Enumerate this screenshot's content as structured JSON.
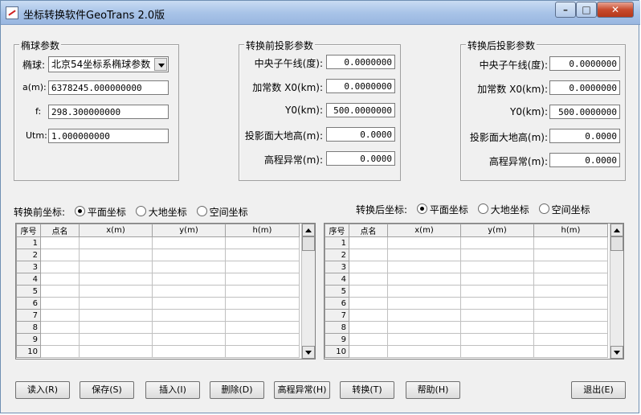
{
  "window": {
    "title": "坐标转换软件GeoTrans 2.0版",
    "min_symbol": "–",
    "max_symbol": "□",
    "close_symbol": "✕"
  },
  "ellipsoid": {
    "legend": "椭球参数",
    "ellipsoid_label": "椭球:",
    "ellipsoid_value": "北京54坐标系椭球参数",
    "a_label": "a(m):",
    "a_value": "6378245.000000000",
    "f_label": "f:",
    "f_value": "298.300000000",
    "utm_label": "Utm:",
    "utm_value": "1.000000000"
  },
  "pre_projection": {
    "legend": "转换前投影参数",
    "meridian_label": "中央子午线(度):",
    "meridian_value": "0.0000000",
    "x0_label": "加常数 X0(km):",
    "x0_value": "0.0000000",
    "y0_label": "Y0(km):",
    "y0_value": "500.0000000",
    "height_label": "投影面大地高(m):",
    "height_value": "0.0000",
    "anomaly_label": "高程异常(m):",
    "anomaly_value": "0.0000"
  },
  "post_projection": {
    "legend": "转换后投影参数",
    "meridian_label": "中央子午线(度):",
    "meridian_value": "0.0000000",
    "x0_label": "加常数 X0(km):",
    "x0_value": "0.0000000",
    "y0_label": "Y0(km):",
    "y0_value": "500.0000000",
    "height_label": "投影面大地高(m):",
    "height_value": "0.0000",
    "anomaly_label": "高程异常(m):",
    "anomaly_value": "0.0000"
  },
  "before_coords": {
    "label": "转换前坐标:",
    "options": [
      "平面坐标",
      "大地坐标",
      "空间坐标"
    ],
    "selected": 0
  },
  "after_coords": {
    "label": "转换后坐标:",
    "options": [
      "平面坐标",
      "大地坐标",
      "空间坐标"
    ],
    "selected": 0
  },
  "grid": {
    "columns": [
      "序号",
      "点名",
      "x(m)",
      "y(m)",
      "h(m)"
    ],
    "row_numbers": [
      "1",
      "2",
      "3",
      "4",
      "5",
      "6",
      "7",
      "8",
      "9",
      "10"
    ]
  },
  "buttons": {
    "read": "读入(R)",
    "save": "保存(S)",
    "insert": "插入(I)",
    "delete": "删除(D)",
    "anomaly": "高程异常(H)",
    "convert": "转换(T)",
    "help": "帮助(H)",
    "exit": "退出(E)"
  }
}
